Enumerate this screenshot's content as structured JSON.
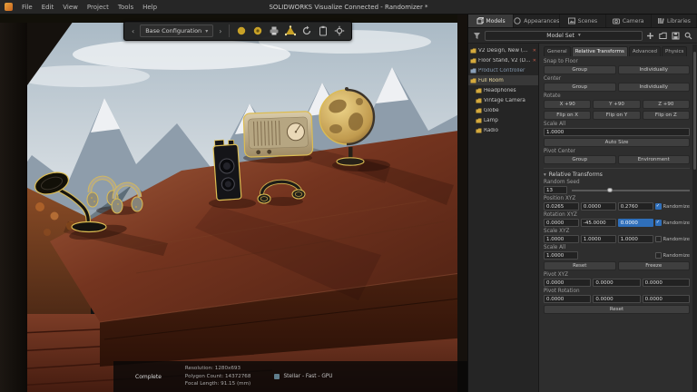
{
  "window": {
    "title": "SOLIDWORKS Visualize Connected - Randomizer *",
    "menus": [
      "File",
      "Edit",
      "View",
      "Project",
      "Tools",
      "Help"
    ]
  },
  "glyphs": {
    "chevron_down": "▾",
    "prev": "‹",
    "next": "›",
    "close": "✕",
    "check": "✓"
  },
  "toolbar": {
    "config": "Base Configuration"
  },
  "status": {
    "complete": "Complete",
    "resolution": "Resolution: 1280x693",
    "polygons": "Polygon Count: 14372768",
    "focal": "Focal Length: 91.15 (mm)",
    "renderer": "Stellar - Fast - GPU"
  },
  "panel": {
    "tabs": [
      "Models",
      "Appearances",
      "Scenes",
      "Camera",
      "Libraries"
    ],
    "model_set": "Model Set",
    "tree": [
      "V2 Design, New (S...",
      "Floor Stand, V2 (D...",
      "Product Controller",
      "Full Room",
      "Headphones",
      "Vintage Camera",
      "Globe",
      "Lamp",
      "Radio"
    ],
    "prop_tabs": [
      "General",
      "Relative Transforms",
      "Advanced",
      "Physics"
    ],
    "snap": {
      "label": "Snap to Floor",
      "group": "Group",
      "individually": "Individually"
    },
    "center": {
      "label": "Center",
      "group": "Group",
      "individually": "Individually"
    },
    "rotate": {
      "label": "Rotate",
      "x": "X +90",
      "y": "Y +90",
      "z": "Z +90",
      "fx": "Flip on X",
      "fy": "Flip on Y",
      "fz": "Flip on Z"
    },
    "scale_all": {
      "label": "Scale All",
      "value": "1.0000",
      "auto": "Auto Size"
    },
    "pivot_center": {
      "label": "Pivot Center",
      "group": "Group",
      "environment": "Environment"
    },
    "rt": {
      "header": "Relative Transforms",
      "seed": {
        "label": "Random Seed",
        "value": "13"
      },
      "position": {
        "label": "Position XYZ",
        "x": "0.0265",
        "y": "0.0000",
        "z": "0.2760",
        "cb": "Randomize"
      },
      "rotation": {
        "label": "Rotation XYZ",
        "x": "0.0000",
        "y": "-45.0000",
        "z": "0.0000",
        "cb": "Randomize"
      },
      "scale": {
        "label": "Scale XYZ",
        "x": "1.0000",
        "y": "1.0000",
        "z": "1.0000",
        "cb": "Randomize"
      },
      "scale_all": {
        "label": "Scale All",
        "x": "1.0000",
        "cb": "Randomize"
      },
      "reset": "Reset",
      "freeze": "Freeze",
      "pivot": {
        "label": "Pivot XYZ",
        "x": "0.0000",
        "y": "0.0000",
        "z": "0.0000"
      },
      "pivot_rotation": {
        "label": "Pivot Rotation",
        "x": "0.0000",
        "y": "0.0000",
        "z": "0.0000"
      },
      "reset2": "Reset"
    }
  }
}
